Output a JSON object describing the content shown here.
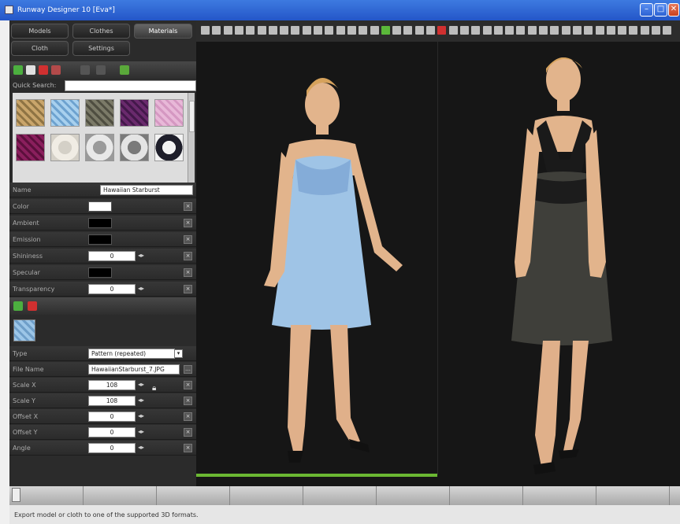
{
  "window": {
    "title": "Runway Designer 10 [Eva*]"
  },
  "tabs": [
    {
      "label": "Models"
    },
    {
      "label": "Clothes"
    },
    {
      "label": "Materials"
    },
    {
      "label": "Cloth"
    },
    {
      "label": "Settings"
    }
  ],
  "search": {
    "label": "Quick Search:",
    "value": ""
  },
  "material_swatches": [
    {
      "color": "#c9a56b",
      "color2": "#8f7444"
    },
    {
      "color": "#a8d0ee",
      "color2": "#6da2cf"
    },
    {
      "color": "#7b7a68",
      "color2": "#4f4e41"
    },
    {
      "color": "#6a2a6d",
      "color2": "#43184a"
    },
    {
      "color": "#e8b8d8",
      "color2": "#d598c2"
    },
    {
      "color": "#8a1f5d",
      "color2": "#5c0f3c"
    },
    {
      "color": "#f0ece4",
      "color2": "#d4d0c7"
    },
    {
      "color": "#e8e8e8",
      "color2": "#9a9a9a"
    },
    {
      "color": "#e4e4e4",
      "color2": "#7a7a7a"
    },
    {
      "color": "#1e1e2a",
      "color2": "#f2f2f2"
    }
  ],
  "material": {
    "name_label": "Name",
    "name_value": "Hawaiian Starburst",
    "color_label": "Color",
    "color_value": "#ffffff",
    "ambient_label": "Ambient",
    "ambient_value": "#000000",
    "emission_label": "Emission",
    "emission_value": "#000000",
    "shininess_label": "Shininess",
    "shininess_value": "0",
    "specular_label": "Specular",
    "specular_value": "#000000",
    "transparency_label": "Transparency",
    "transparency_value": "0"
  },
  "texture": {
    "type_label": "Type",
    "type_value": "Pattern (repeated)",
    "file_label": "File Name",
    "file_value": "HawaiianStarburst_7.JPG",
    "scalex_label": "Scale X",
    "scalex_value": "108",
    "scaley_label": "Scale Y",
    "scaley_value": "108",
    "offsetx_label": "Offset X",
    "offsetx_value": "0",
    "offsety_label": "Offset Y",
    "offsety_value": "0",
    "angle_label": "Angle",
    "angle_value": "0"
  },
  "statusbar": {
    "text": "Export model or cloth to one of the supported 3D formats."
  },
  "colors": {
    "accent": "#6bb832",
    "titlebar": "#2456c8"
  }
}
